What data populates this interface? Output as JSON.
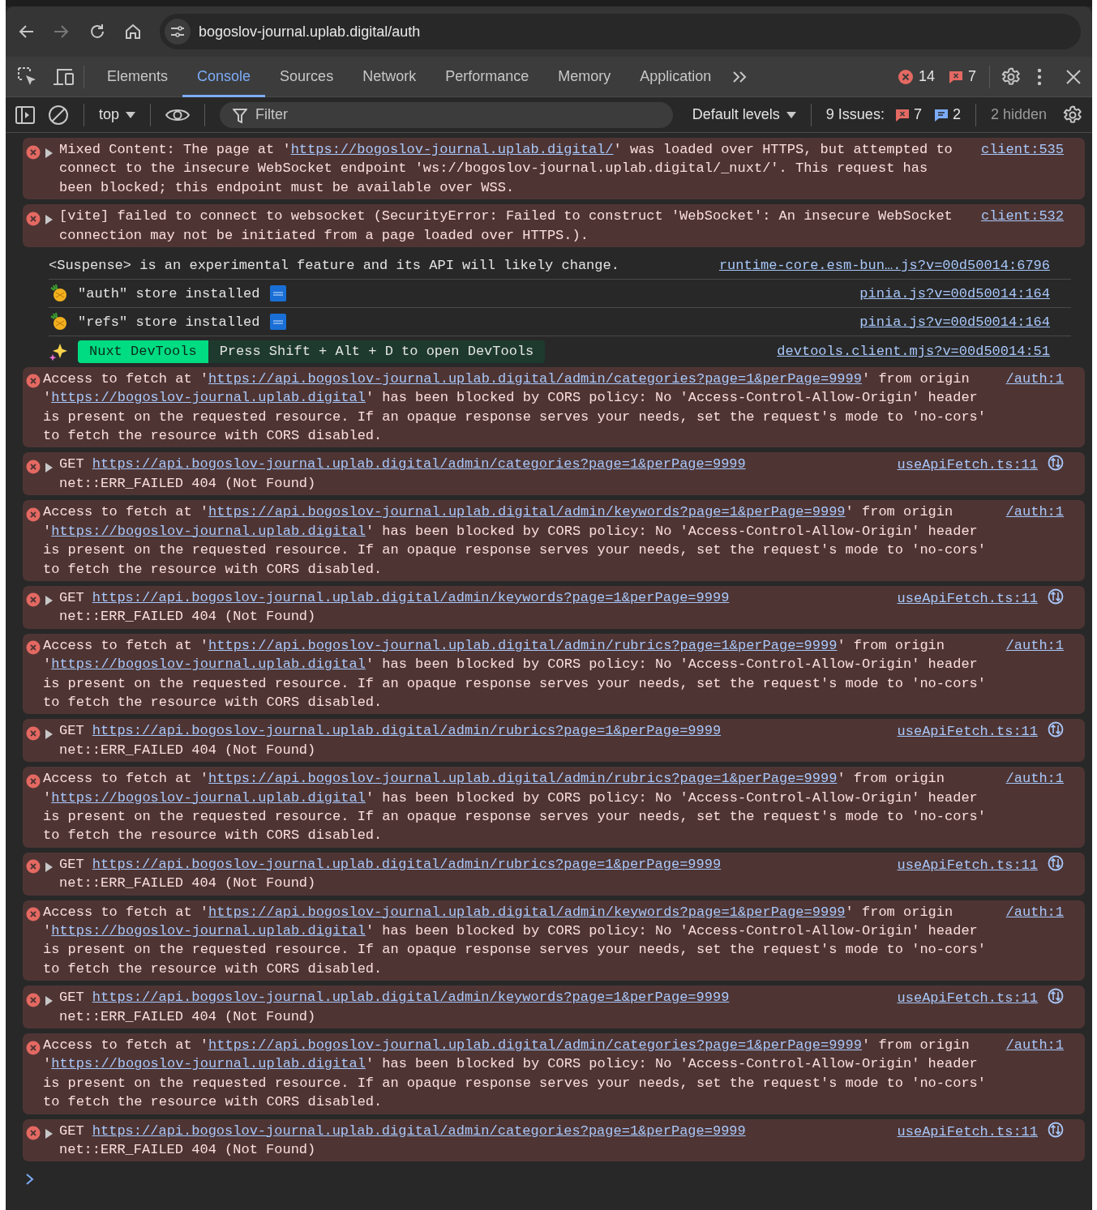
{
  "browser": {
    "address": "bogoslov-journal.uplab.digital/auth"
  },
  "devtools": {
    "tabs": [
      {
        "label": "Elements",
        "selected": false
      },
      {
        "label": "Console",
        "selected": true
      },
      {
        "label": "Sources",
        "selected": false
      },
      {
        "label": "Network",
        "selected": false
      },
      {
        "label": "Performance",
        "selected": false
      },
      {
        "label": "Memory",
        "selected": false
      },
      {
        "label": "Application",
        "selected": false
      }
    ],
    "error_count": "14",
    "issue_count": "7"
  },
  "console_toolbar": {
    "context": "top",
    "filter": {
      "placeholder": "Filter"
    },
    "levels": "Default levels",
    "issues_label": "9 Issues:",
    "issues_errors": "7",
    "issues_info": "2",
    "hidden": "2 hidden"
  },
  "messages": [
    {
      "kind": "error",
      "expandable": true,
      "expanded": false,
      "source": "client:535",
      "request_icon": false,
      "lines": [
        [
          {
            "kind": "text",
            "text": "Mixed Content: The page at '"
          },
          {
            "kind": "link",
            "text": "https://bogoslov-journal.uplab.digital/"
          },
          {
            "kind": "text",
            "text": "' was loaded over HTTPS, but attempted to connect to the insecure WebSocket endpoint 'ws://bogoslov-journal.uplab.digital/_nuxt/'. This request has been blocked; this endpoint must be available over WSS."
          }
        ]
      ]
    },
    {
      "kind": "error",
      "expandable": true,
      "expanded": false,
      "source": "client:532",
      "request_icon": false,
      "lines": [
        [
          {
            "kind": "text",
            "text": "[vite] failed to connect to websocket (SecurityError: Failed to construct 'WebSocket': An insecure WebSocket connection may not be initiated from a page loaded over HTTPS.)."
          }
        ]
      ]
    },
    {
      "kind": "log",
      "source": "runtime-core.esm-bun….js?v=00d50014:6796",
      "lines": [
        [
          {
            "kind": "text",
            "text": "<Suspense> is an experimental feature and its API will likely change."
          }
        ]
      ]
    },
    {
      "kind": "store",
      "source": "pinia.js?v=00d50014:164",
      "lines": [
        [
          {
            "kind": "text",
            "text": "\"auth\" store installed"
          }
        ]
      ]
    },
    {
      "kind": "store",
      "source": "pinia.js?v=00d50014:164",
      "lines": [
        [
          {
            "kind": "text",
            "text": "\"refs\" store installed"
          }
        ]
      ]
    },
    {
      "kind": "nuxt",
      "source": "devtools.client.mjs?v=00d50014:51",
      "badge": "Nuxt DevTools",
      "lines": [
        [
          {
            "kind": "text",
            "text": "Press Shift + Alt + D to open DevTools"
          }
        ]
      ]
    },
    {
      "kind": "error",
      "expandable": false,
      "source": "/auth:1",
      "request_icon": false,
      "lines": [
        [
          {
            "kind": "text",
            "text": "Access to fetch at '"
          },
          {
            "kind": "link",
            "text": "https://api.bogoslov-journal.uplab.digital/admin/categories?page=1&perPage=9999"
          },
          {
            "kind": "text",
            "text": "' from origin '"
          },
          {
            "kind": "link",
            "text": "https://bogoslov-journal.uplab.digital"
          },
          {
            "kind": "text",
            "text": "' has been blocked by CORS policy: No 'Access-Control-Allow-Origin' header is present on the requested resource. If an opaque response serves your needs, set the request's mode to 'no-cors' to fetch the resource with CORS disabled."
          }
        ]
      ]
    },
    {
      "kind": "error",
      "expandable": true,
      "expanded": false,
      "source": "useApiFetch.ts:11",
      "request_icon": true,
      "lines": [
        [
          {
            "kind": "text",
            "text": "GET "
          },
          {
            "kind": "link",
            "text": "https://api.bogoslov-journal.uplab.digital/admin/categories?page=1&perPage=9999"
          }
        ],
        [
          {
            "kind": "text",
            "text": "net::ERR_FAILED 404 (Not Found)"
          }
        ]
      ]
    },
    {
      "kind": "error",
      "expandable": false,
      "source": "/auth:1",
      "request_icon": false,
      "lines": [
        [
          {
            "kind": "text",
            "text": "Access to fetch at '"
          },
          {
            "kind": "link",
            "text": "https://api.bogoslov-journal.uplab.digital/admin/keywords?page=1&perPage=9999"
          },
          {
            "kind": "text",
            "text": "' from origin '"
          },
          {
            "kind": "link",
            "text": "https://bogoslov-journal.uplab.digital"
          },
          {
            "kind": "text",
            "text": "' has been blocked by CORS policy: No 'Access-Control-Allow-Origin' header is present on the requested resource. If an opaque response serves your needs, set the request's mode to 'no-cors' to fetch the resource with CORS disabled."
          }
        ]
      ]
    },
    {
      "kind": "error",
      "expandable": true,
      "expanded": false,
      "source": "useApiFetch.ts:11",
      "request_icon": true,
      "lines": [
        [
          {
            "kind": "text",
            "text": "GET "
          },
          {
            "kind": "link",
            "text": "https://api.bogoslov-journal.uplab.digital/admin/keywords?page=1&perPage=9999"
          }
        ],
        [
          {
            "kind": "text",
            "text": "net::ERR_FAILED 404 (Not Found)"
          }
        ]
      ]
    },
    {
      "kind": "error",
      "expandable": false,
      "source": "/auth:1",
      "request_icon": false,
      "lines": [
        [
          {
            "kind": "text",
            "text": "Access to fetch at '"
          },
          {
            "kind": "link",
            "text": "https://api.bogoslov-journal.uplab.digital/admin/rubrics?page=1&perPage=9999"
          },
          {
            "kind": "text",
            "text": "' from origin '"
          },
          {
            "kind": "link",
            "text": "https://bogoslov-journal.uplab.digital"
          },
          {
            "kind": "text",
            "text": "' has been blocked by CORS policy: No 'Access-Control-Allow-Origin' header is present on the requested resource. If an opaque response serves your needs, set the request's mode to 'no-cors' to fetch the resource with CORS disabled."
          }
        ]
      ]
    },
    {
      "kind": "error",
      "expandable": true,
      "expanded": false,
      "source": "useApiFetch.ts:11",
      "request_icon": true,
      "lines": [
        [
          {
            "kind": "text",
            "text": "GET "
          },
          {
            "kind": "link",
            "text": "https://api.bogoslov-journal.uplab.digital/admin/rubrics?page=1&perPage=9999"
          }
        ],
        [
          {
            "kind": "text",
            "text": "net::ERR_FAILED 404 (Not Found)"
          }
        ]
      ]
    },
    {
      "kind": "error",
      "expandable": false,
      "source": "/auth:1",
      "request_icon": false,
      "lines": [
        [
          {
            "kind": "text",
            "text": "Access to fetch at '"
          },
          {
            "kind": "link",
            "text": "https://api.bogoslov-journal.uplab.digital/admin/rubrics?page=1&perPage=9999"
          },
          {
            "kind": "text",
            "text": "' from origin '"
          },
          {
            "kind": "link",
            "text": "https://bogoslov-journal.uplab.digital"
          },
          {
            "kind": "text",
            "text": "' has been blocked by CORS policy: No 'Access-Control-Allow-Origin' header is present on the requested resource. If an opaque response serves your needs, set the request's mode to 'no-cors' to fetch the resource with CORS disabled."
          }
        ]
      ]
    },
    {
      "kind": "error",
      "expandable": true,
      "expanded": false,
      "source": "useApiFetch.ts:11",
      "request_icon": true,
      "lines": [
        [
          {
            "kind": "text",
            "text": "GET "
          },
          {
            "kind": "link",
            "text": "https://api.bogoslov-journal.uplab.digital/admin/rubrics?page=1&perPage=9999"
          }
        ],
        [
          {
            "kind": "text",
            "text": "net::ERR_FAILED 404 (Not Found)"
          }
        ]
      ]
    },
    {
      "kind": "error",
      "expandable": false,
      "source": "/auth:1",
      "request_icon": false,
      "lines": [
        [
          {
            "kind": "text",
            "text": "Access to fetch at '"
          },
          {
            "kind": "link",
            "text": "https://api.bogoslov-journal.uplab.digital/admin/keywords?page=1&perPage=9999"
          },
          {
            "kind": "text",
            "text": "' from origin '"
          },
          {
            "kind": "link",
            "text": "https://bogoslov-journal.uplab.digital"
          },
          {
            "kind": "text",
            "text": "' has been blocked by CORS policy: No 'Access-Control-Allow-Origin' header is present on the requested resource. If an opaque response serves your needs, set the request's mode to 'no-cors' to fetch the resource with CORS disabled."
          }
        ]
      ]
    },
    {
      "kind": "error",
      "expandable": true,
      "expanded": false,
      "source": "useApiFetch.ts:11",
      "request_icon": true,
      "lines": [
        [
          {
            "kind": "text",
            "text": "GET "
          },
          {
            "kind": "link",
            "text": "https://api.bogoslov-journal.uplab.digital/admin/keywords?page=1&perPage=9999"
          }
        ],
        [
          {
            "kind": "text",
            "text": "net::ERR_FAILED 404 (Not Found)"
          }
        ]
      ]
    },
    {
      "kind": "error",
      "expandable": false,
      "source": "/auth:1",
      "request_icon": false,
      "lines": [
        [
          {
            "kind": "text",
            "text": "Access to fetch at '"
          },
          {
            "kind": "link",
            "text": "https://api.bogoslov-journal.uplab.digital/admin/categories?page=1&perPage=9999"
          },
          {
            "kind": "text",
            "text": "' from origin '"
          },
          {
            "kind": "link",
            "text": "https://bogoslov-journal.uplab.digital"
          },
          {
            "kind": "text",
            "text": "' has been blocked by CORS policy: No 'Access-Control-Allow-Origin' header is present on the requested resource. If an opaque response serves your needs, set the request's mode to 'no-cors' to fetch the resource with CORS disabled."
          }
        ]
      ]
    },
    {
      "kind": "error",
      "expandable": true,
      "expanded": false,
      "source": "useApiFetch.ts:11",
      "request_icon": true,
      "lines": [
        [
          {
            "kind": "text",
            "text": "GET "
          },
          {
            "kind": "link",
            "text": "https://api.bogoslov-journal.uplab.digital/admin/categories?page=1&perPage=9999"
          }
        ],
        [
          {
            "kind": "text",
            "text": "net::ERR_FAILED 404 (Not Found)"
          }
        ]
      ]
    }
  ]
}
